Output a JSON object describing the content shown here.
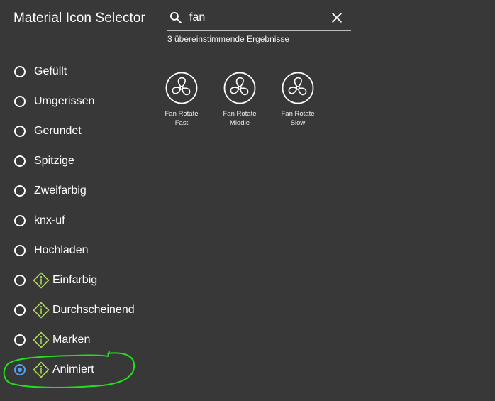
{
  "header": {
    "title": "Material Icon Selector"
  },
  "search": {
    "value": "fan",
    "icon": "search-icon",
    "clear_icon": "close-icon",
    "result_count": "3 übereinstimmende Ergebnisse"
  },
  "options": [
    {
      "label": "Gefüllt",
      "checked": false,
      "info": false
    },
    {
      "label": "Umgerissen",
      "checked": false,
      "info": false
    },
    {
      "label": "Gerundet",
      "checked": false,
      "info": false
    },
    {
      "label": "Spitzige",
      "checked": false,
      "info": false
    },
    {
      "label": "Zweifarbig",
      "checked": false,
      "info": false
    },
    {
      "label": "knx-uf",
      "checked": false,
      "info": false
    },
    {
      "label": "Hochladen",
      "checked": false,
      "info": false
    },
    {
      "label": "Einfarbig",
      "checked": false,
      "info": true
    },
    {
      "label": "Durchscheinend",
      "checked": false,
      "info": true
    },
    {
      "label": "Marken",
      "checked": false,
      "info": true
    },
    {
      "label": "Animiert",
      "checked": true,
      "info": true
    }
  ],
  "results": [
    {
      "label_line1": "Fan Rotate",
      "label_line2": "Fast",
      "icon": "fan-icon"
    },
    {
      "label_line1": "Fan Rotate",
      "label_line2": "Middle",
      "icon": "fan-icon"
    },
    {
      "label_line1": "Fan Rotate",
      "label_line2": "Slow",
      "icon": "fan-icon"
    }
  ],
  "colors": {
    "background": "#383838",
    "radio_selected": "#4fa3f0",
    "info_icon": "#a7d35a",
    "highlight": "#22e01c"
  }
}
